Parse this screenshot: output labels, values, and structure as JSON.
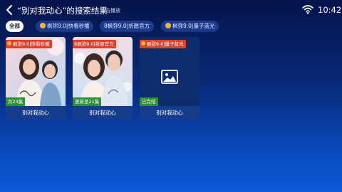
{
  "header": {
    "title": "“别对我动心”的搜索结果",
    "hint": "点击播放",
    "time": "10:42"
  },
  "filters": [
    {
      "label": "全部",
      "active": true,
      "icon": ""
    },
    {
      "label": "枫弥9.0|快看秒播",
      "active": false,
      "icon": "coin-icon"
    },
    {
      "label": "8枫弥9.0|祈愿官方",
      "active": false,
      "icon": ""
    },
    {
      "label": "枫弥9.0|量子蓝光",
      "active": false,
      "icon": "coin-icon"
    }
  ],
  "results": [
    {
      "source": "枫弥9.0|快看秒播",
      "source_icon": "coin-icon",
      "episodes": "共24集",
      "title": "别对我动心",
      "poster": "drama-poster-couple"
    },
    {
      "source": "8枫弥9.0|祈愿官方",
      "source_icon": "",
      "episodes": "更新至21集",
      "title": "别对我动心",
      "poster": "drama-poster-couple"
    },
    {
      "source": "枫弥9.0|量子蓝光",
      "source_icon": "coin-icon",
      "episodes": "已完结",
      "title": "别对我动心",
      "poster": "image-placeholder"
    }
  ],
  "colors": {
    "source_badge": "#d9432f",
    "episode_badge": "#2f8f3a",
    "active_chip": "#ffffff",
    "chip": "#1b3b8a"
  }
}
